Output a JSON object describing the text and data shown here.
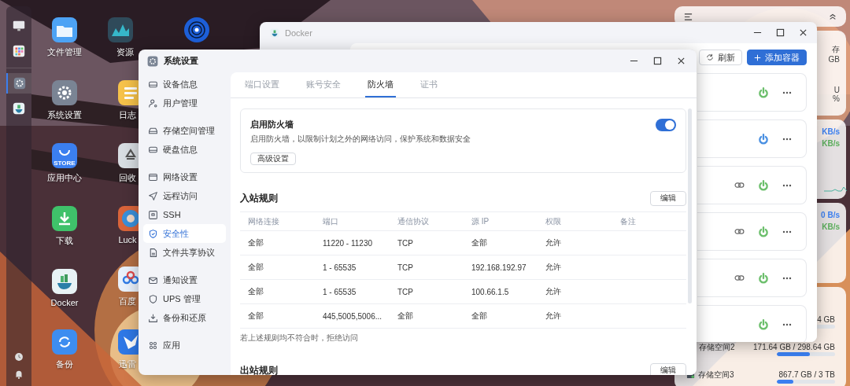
{
  "dock": {
    "items": [
      {
        "kind": "monitor",
        "selected": false
      },
      {
        "kind": "apps",
        "selected": false
      },
      {
        "kind": "settings",
        "selected": true
      },
      {
        "kind": "docker",
        "selected": false
      }
    ],
    "bottom": [
      {
        "kind": "clock"
      },
      {
        "kind": "bell"
      }
    ]
  },
  "desktop_columns": [
    {
      "icons": [
        {
          "kind": "folder",
          "label": "文件管理"
        },
        {
          "kind": "settings",
          "label": "系统设置"
        },
        {
          "kind": "store",
          "label": "应用中心",
          "badge": "STORE"
        },
        {
          "kind": "download",
          "label": "下载"
        },
        {
          "kind": "docker",
          "label": "Docker"
        },
        {
          "kind": "backup",
          "label": "备份"
        }
      ]
    },
    {
      "icons": [
        {
          "kind": "monitor",
          "label": "资源"
        },
        {
          "kind": "log",
          "label": "日志"
        },
        {
          "kind": "recycle",
          "label": "回收"
        },
        {
          "kind": "lucky",
          "label": "Luck"
        },
        {
          "kind": "cloud",
          "label": "百度"
        },
        {
          "kind": "bird",
          "label": "迅雷"
        }
      ]
    },
    {
      "icons": [
        {
          "kind": "disc"
        }
      ]
    }
  ],
  "widgets": {
    "memory": {
      "label": "存",
      "value": "GB"
    },
    "cpu": {
      "label": "U",
      "value": "%"
    },
    "network": [
      {
        "upload": "KB/s",
        "download": "KB/s"
      },
      {
        "upload": "0 B/s",
        "download": "KB/s"
      }
    ],
    "storage": [
      {
        "usage": "4 GB"
      },
      {
        "name": "存储空间2",
        "usage": "171.64 GB / 298.64 GB",
        "level": 0.57
      },
      {
        "name": "存储空间3",
        "usage": "867.7 GB / 3 TB",
        "level": 0.29
      }
    ]
  },
  "docker_window": {
    "title": "Docker",
    "refresh": "刷新",
    "add": "添加容器",
    "containers": [
      {
        "link": false,
        "color": "#6cbf6c"
      },
      {
        "link": false,
        "color": "#4a90e2"
      },
      {
        "link": true,
        "color": "#6cbf6c"
      },
      {
        "link": true,
        "color": "#6cbf6c"
      },
      {
        "link": true,
        "color": "#6cbf6c"
      },
      {
        "link": false,
        "color": "#6cbf6c"
      }
    ]
  },
  "settings_window": {
    "title": "系统设置",
    "sidebar": {
      "groups": [
        {
          "items": [
            {
              "label": "设备信息",
              "selected": false
            },
            {
              "label": "用户管理",
              "selected": false
            }
          ]
        },
        {
          "items": [
            {
              "label": "存储空间管理",
              "selected": false
            },
            {
              "label": "硬盘信息",
              "selected": false
            }
          ]
        },
        {
          "items": [
            {
              "label": "网络设置",
              "selected": false
            },
            {
              "label": "远程访问",
              "selected": false
            },
            {
              "label": "SSH",
              "selected": false
            },
            {
              "label": "安全性",
              "selected": true
            },
            {
              "label": "文件共享协议",
              "selected": false
            }
          ]
        },
        {
          "items": [
            {
              "label": "通知设置",
              "selected": false
            },
            {
              "label": "UPS 管理",
              "selected": false
            },
            {
              "label": "备份和还原",
              "selected": false
            }
          ]
        },
        {
          "items": [
            {
              "label": "应用",
              "selected": false
            }
          ]
        }
      ]
    },
    "tabs": [
      {
        "label": "端口设置",
        "selected": false
      },
      {
        "label": "账号安全",
        "selected": false
      },
      {
        "label": "防火墙",
        "selected": true
      },
      {
        "label": "证书",
        "selected": false
      }
    ],
    "firewall": {
      "title": "启用防火墙",
      "description": "启用防火墙，以限制计划之外的网络访问，保护系统和数据安全",
      "button": "高级设置",
      "enabled": true
    },
    "inbound": {
      "title": "入站规则",
      "edit": "编辑",
      "columns": [
        "网络连接",
        "端口",
        "通信协议",
        "源 IP",
        "权限",
        "备注"
      ],
      "rows": [
        [
          "全部",
          "11220 - 11230",
          "TCP",
          "全部",
          "允许"
        ],
        [
          "全部",
          "1 - 65535",
          "TCP",
          "192.168.192.97",
          "允许"
        ],
        [
          "全部",
          "1 - 65535",
          "TCP",
          "100.66.1.5",
          "允许"
        ],
        [
          "全部",
          "445,5005,5006...",
          "全部",
          "全部",
          "允许"
        ]
      ],
      "note": "若上述规则均不符合时，拒绝访问"
    },
    "outbound": {
      "title": "出站规则",
      "edit": "编辑"
    }
  }
}
